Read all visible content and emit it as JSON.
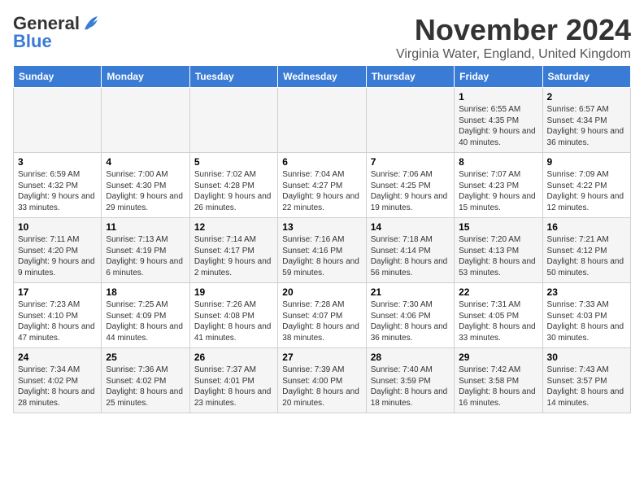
{
  "header": {
    "title": "November 2024",
    "location": "Virginia Water, England, United Kingdom",
    "logo_general": "General",
    "logo_blue": "Blue"
  },
  "weekdays": [
    "Sunday",
    "Monday",
    "Tuesday",
    "Wednesday",
    "Thursday",
    "Friday",
    "Saturday"
  ],
  "weeks": [
    [
      {
        "day": "",
        "info": ""
      },
      {
        "day": "",
        "info": ""
      },
      {
        "day": "",
        "info": ""
      },
      {
        "day": "",
        "info": ""
      },
      {
        "day": "",
        "info": ""
      },
      {
        "day": "1",
        "info": "Sunrise: 6:55 AM\nSunset: 4:35 PM\nDaylight: 9 hours and 40 minutes."
      },
      {
        "day": "2",
        "info": "Sunrise: 6:57 AM\nSunset: 4:34 PM\nDaylight: 9 hours and 36 minutes."
      }
    ],
    [
      {
        "day": "3",
        "info": "Sunrise: 6:59 AM\nSunset: 4:32 PM\nDaylight: 9 hours and 33 minutes."
      },
      {
        "day": "4",
        "info": "Sunrise: 7:00 AM\nSunset: 4:30 PM\nDaylight: 9 hours and 29 minutes."
      },
      {
        "day": "5",
        "info": "Sunrise: 7:02 AM\nSunset: 4:28 PM\nDaylight: 9 hours and 26 minutes."
      },
      {
        "day": "6",
        "info": "Sunrise: 7:04 AM\nSunset: 4:27 PM\nDaylight: 9 hours and 22 minutes."
      },
      {
        "day": "7",
        "info": "Sunrise: 7:06 AM\nSunset: 4:25 PM\nDaylight: 9 hours and 19 minutes."
      },
      {
        "day": "8",
        "info": "Sunrise: 7:07 AM\nSunset: 4:23 PM\nDaylight: 9 hours and 15 minutes."
      },
      {
        "day": "9",
        "info": "Sunrise: 7:09 AM\nSunset: 4:22 PM\nDaylight: 9 hours and 12 minutes."
      }
    ],
    [
      {
        "day": "10",
        "info": "Sunrise: 7:11 AM\nSunset: 4:20 PM\nDaylight: 9 hours and 9 minutes."
      },
      {
        "day": "11",
        "info": "Sunrise: 7:13 AM\nSunset: 4:19 PM\nDaylight: 9 hours and 6 minutes."
      },
      {
        "day": "12",
        "info": "Sunrise: 7:14 AM\nSunset: 4:17 PM\nDaylight: 9 hours and 2 minutes."
      },
      {
        "day": "13",
        "info": "Sunrise: 7:16 AM\nSunset: 4:16 PM\nDaylight: 8 hours and 59 minutes."
      },
      {
        "day": "14",
        "info": "Sunrise: 7:18 AM\nSunset: 4:14 PM\nDaylight: 8 hours and 56 minutes."
      },
      {
        "day": "15",
        "info": "Sunrise: 7:20 AM\nSunset: 4:13 PM\nDaylight: 8 hours and 53 minutes."
      },
      {
        "day": "16",
        "info": "Sunrise: 7:21 AM\nSunset: 4:12 PM\nDaylight: 8 hours and 50 minutes."
      }
    ],
    [
      {
        "day": "17",
        "info": "Sunrise: 7:23 AM\nSunset: 4:10 PM\nDaylight: 8 hours and 47 minutes."
      },
      {
        "day": "18",
        "info": "Sunrise: 7:25 AM\nSunset: 4:09 PM\nDaylight: 8 hours and 44 minutes."
      },
      {
        "day": "19",
        "info": "Sunrise: 7:26 AM\nSunset: 4:08 PM\nDaylight: 8 hours and 41 minutes."
      },
      {
        "day": "20",
        "info": "Sunrise: 7:28 AM\nSunset: 4:07 PM\nDaylight: 8 hours and 38 minutes."
      },
      {
        "day": "21",
        "info": "Sunrise: 7:30 AM\nSunset: 4:06 PM\nDaylight: 8 hours and 36 minutes."
      },
      {
        "day": "22",
        "info": "Sunrise: 7:31 AM\nSunset: 4:05 PM\nDaylight: 8 hours and 33 minutes."
      },
      {
        "day": "23",
        "info": "Sunrise: 7:33 AM\nSunset: 4:03 PM\nDaylight: 8 hours and 30 minutes."
      }
    ],
    [
      {
        "day": "24",
        "info": "Sunrise: 7:34 AM\nSunset: 4:02 PM\nDaylight: 8 hours and 28 minutes."
      },
      {
        "day": "25",
        "info": "Sunrise: 7:36 AM\nSunset: 4:02 PM\nDaylight: 8 hours and 25 minutes."
      },
      {
        "day": "26",
        "info": "Sunrise: 7:37 AM\nSunset: 4:01 PM\nDaylight: 8 hours and 23 minutes."
      },
      {
        "day": "27",
        "info": "Sunrise: 7:39 AM\nSunset: 4:00 PM\nDaylight: 8 hours and 20 minutes."
      },
      {
        "day": "28",
        "info": "Sunrise: 7:40 AM\nSunset: 3:59 PM\nDaylight: 8 hours and 18 minutes."
      },
      {
        "day": "29",
        "info": "Sunrise: 7:42 AM\nSunset: 3:58 PM\nDaylight: 8 hours and 16 minutes."
      },
      {
        "day": "30",
        "info": "Sunrise: 7:43 AM\nSunset: 3:57 PM\nDaylight: 8 hours and 14 minutes."
      }
    ]
  ]
}
